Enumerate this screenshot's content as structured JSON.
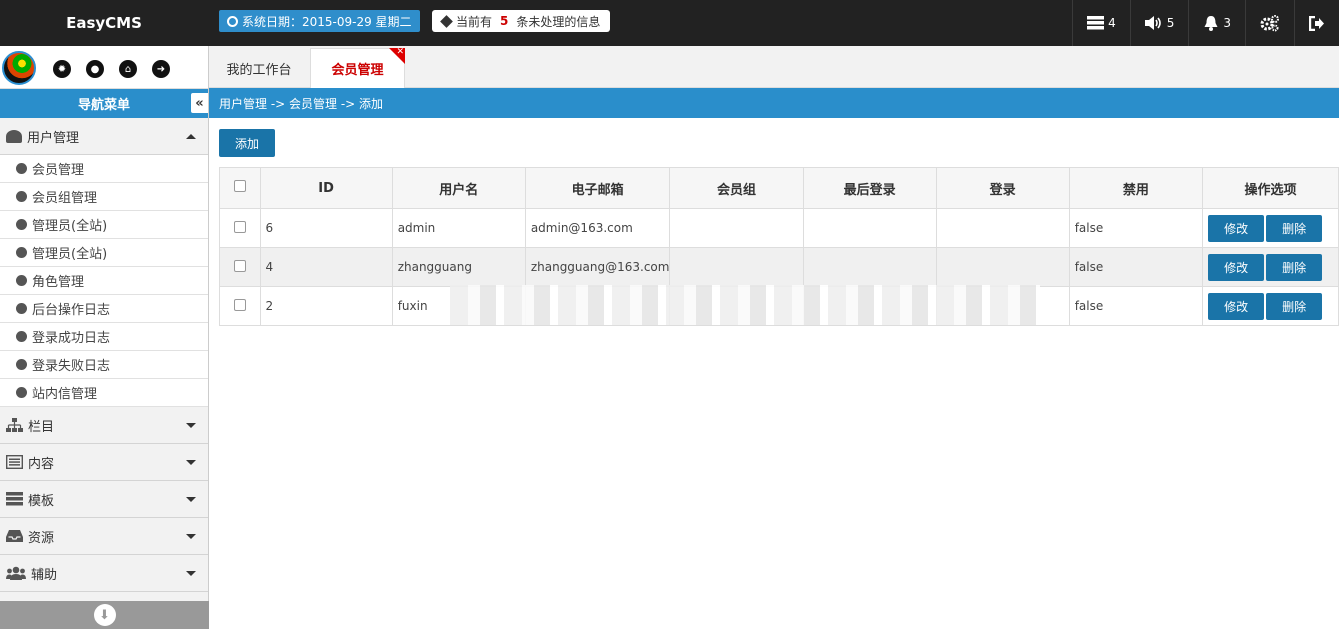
{
  "brand": "EasyCMS",
  "header": {
    "date_text": "系统日期：2015-09-29 星期二",
    "msg_prefix": "当前有",
    "msg_count": "5",
    "msg_suffix": "条未处理的信息",
    "right_buttons": [
      {
        "icon": "server-icon",
        "count": "4"
      },
      {
        "icon": "volume-icon",
        "count": "5"
      },
      {
        "icon": "bell-icon",
        "count": "3"
      },
      {
        "icon": "gears-icon",
        "count": ""
      },
      {
        "icon": "logout-icon",
        "count": ""
      }
    ]
  },
  "sidebar": {
    "nav_title": "导航菜单",
    "sections": [
      {
        "label": "用户管理",
        "icon": "user-icon",
        "expanded": true
      },
      {
        "label": "栏目",
        "icon": "sitemap-icon"
      },
      {
        "label": "内容",
        "icon": "list-icon"
      },
      {
        "label": "模板",
        "icon": "server-icon"
      },
      {
        "label": "资源",
        "icon": "inbox-icon"
      },
      {
        "label": "辅助",
        "icon": "users-icon"
      }
    ],
    "user_items": [
      "会员管理",
      "会员组管理",
      "管理员(全站)",
      "管理员(全站)",
      "角色管理",
      "后台操作日志",
      "登录成功日志",
      "登录失败日志",
      "站内信管理"
    ]
  },
  "tabs": [
    {
      "label": "我的工作台"
    },
    {
      "label": "会员管理",
      "active": true
    }
  ],
  "breadcrumb": "用户管理 -> 会员管理 -> 添加",
  "toolbar": {
    "add_label": "添加"
  },
  "table": {
    "headers": [
      "ID",
      "用户名",
      "电子邮箱",
      "会员组",
      "最后登录",
      "登录",
      "禁用",
      "操作选项"
    ],
    "rows": [
      {
        "id": "6",
        "username": "admin",
        "email": "admin@163.com",
        "group": "",
        "last_login": "",
        "login": "",
        "disabled": "false"
      },
      {
        "id": "4",
        "username": "zhangguang",
        "email": "zhangguang@163.com",
        "group": "",
        "last_login": "",
        "login": "",
        "disabled": "false"
      },
      {
        "id": "2",
        "username": "fuxin",
        "email": "",
        "group": "",
        "last_login": "",
        "login": "",
        "disabled": "false"
      }
    ],
    "edit_label": "修改",
    "delete_label": "删除"
  },
  "colors": {
    "accent": "#2a8ecb",
    "button": "#1a74a8",
    "topbar": "#222222",
    "active_tab": "#cc0000"
  }
}
